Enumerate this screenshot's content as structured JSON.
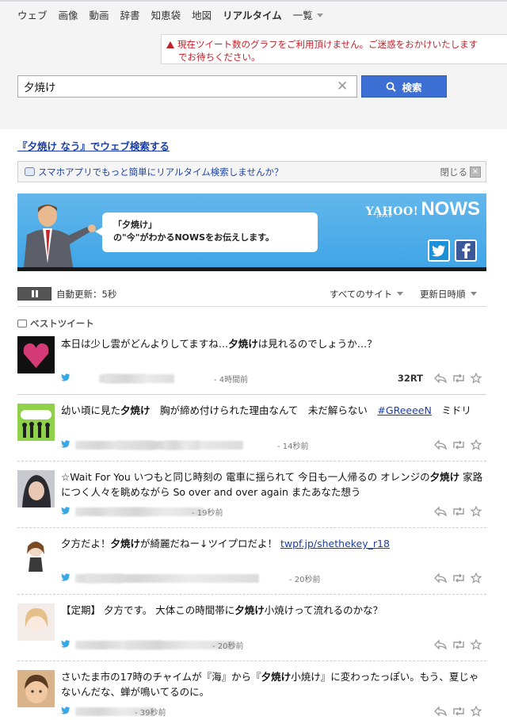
{
  "nav": {
    "items": [
      "ウェブ",
      "画像",
      "動画",
      "辞書",
      "知恵袋",
      "地図"
    ],
    "active": "リアルタイム",
    "more": "一覧"
  },
  "alert": {
    "line1": "現在ツイート数のグラフをご利用頂けません。ご迷惑をおかけいたします",
    "line2": "でお待ちください。"
  },
  "search": {
    "value": "夕焼け",
    "button_label": "検索"
  },
  "web_search_link": "『夕焼け なう』でウェブ検索する",
  "promo": {
    "text": "スマホアプリでもっと簡単にリアルタイム検索しませんか？",
    "close_label": "閉じる"
  },
  "banner": {
    "line1": "「夕焼け」",
    "line2": "の\"今\"がわかるNOWSをお伝えします。",
    "logo_yahoo": "YAHOO!",
    "logo_japan": "JAPAN",
    "logo_nows": "NOWS"
  },
  "controls": {
    "auto_update": "自動更新：5秒",
    "sites": "すべてのサイト",
    "sort": "更新日時順"
  },
  "best_tweet_label": "ベストツイート",
  "tweets": [
    {
      "parts": [
        [
          "本日は少し雲がどんよりしてますね…",
          false
        ],
        [
          "夕焼け",
          true
        ],
        [
          "は見れるのでしょうか…？",
          false
        ]
      ],
      "time": "4時間前",
      "rt": "32RT",
      "avatar_color": "#d43a75"
    },
    {
      "parts": [
        [
          "幼い頃に見た",
          false
        ],
        [
          "夕焼け",
          true
        ],
        [
          "　胸が締め付けられた理由なんて　未だ解らない　",
          false
        ],
        [
          "#GReeeeN",
          "tag"
        ],
        [
          "　ミドリ",
          false
        ]
      ],
      "time": "14秒前",
      "rt": "",
      "avatar_color": "#7ec83a"
    },
    {
      "parts": [
        [
          "☆Wait For You いつもと同じ時刻の 電車に揺られて 今日も一人帰るの オレンジの",
          false
        ],
        [
          "夕焼け",
          true
        ],
        [
          " 家路につく人々を眺めながら So over and over again またあなた想う",
          false
        ]
      ],
      "time": "19秒前",
      "rt": "",
      "avatar_color": "#3a3a44"
    },
    {
      "parts": [
        [
          "夕方だよ！",
          false
        ],
        [
          "夕焼け",
          true
        ],
        [
          "が綺麗だねー↓ツイプロだよ！ ",
          false
        ],
        [
          "twpf.jp/shethekey_r18",
          "tag"
        ]
      ],
      "time": "20秒前",
      "rt": "",
      "avatar_color": "#b48a55"
    },
    {
      "parts": [
        [
          "【定期】 夕方です。 大体この時間帯に",
          false
        ],
        [
          "夕焼け",
          true
        ],
        [
          "小焼けって流れるのかな？",
          false
        ]
      ],
      "time": "20秒前",
      "rt": "",
      "avatar_color": "#e8d7cf"
    },
    {
      "parts": [
        [
          "さいたま市の17時のチャイムが『海』から『",
          false
        ],
        [
          "夕焼け",
          true
        ],
        [
          "小焼け』に変わったっぽい。もう、夏じゃないんだな、蝉が鳴いてるのに。",
          false
        ]
      ],
      "time": "39秒前",
      "rt": "",
      "avatar_color": "#a86a3c"
    }
  ]
}
